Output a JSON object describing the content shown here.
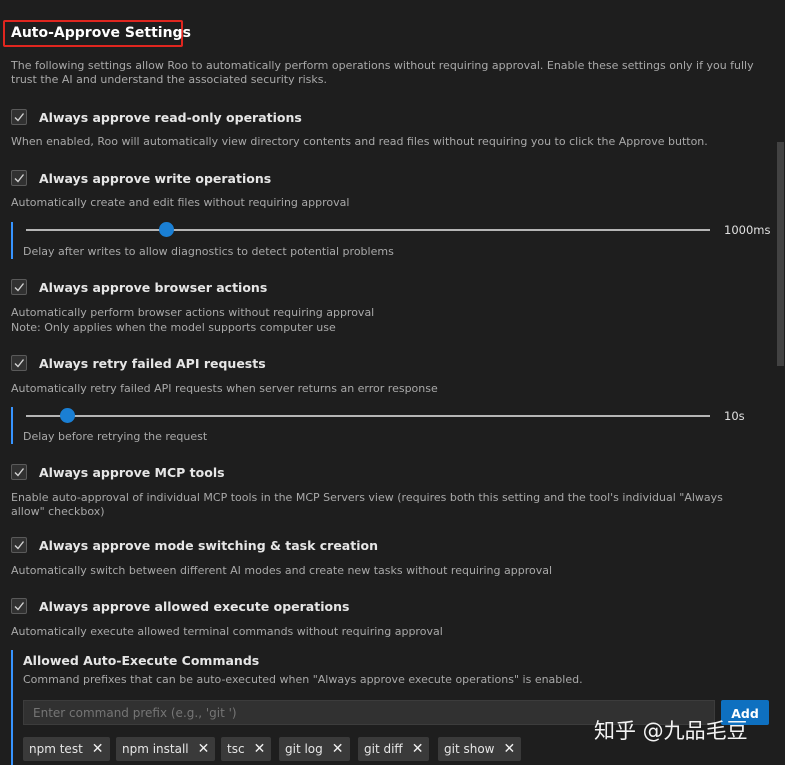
{
  "title": "Auto-Approve Settings",
  "intro": "The following settings allow Roo to automatically perform operations without requiring approval. Enable these settings only if you fully trust the AI and understand the associated security risks.",
  "settings": [
    {
      "label": "Always approve read-only operations",
      "checked": true,
      "desc": [
        "When enabled, Roo will automatically view directory contents and read files without requiring you to click the Approve button."
      ]
    },
    {
      "label": "Always approve write operations",
      "checked": true,
      "desc": [
        "Automatically create and edit files without requiring approval"
      ],
      "slider": {
        "value": "1000ms",
        "fraction": 0.2,
        "desc": "Delay after writes to allow diagnostics to detect potential problems"
      }
    },
    {
      "label": "Always approve browser actions",
      "checked": true,
      "desc": [
        "Automatically perform browser actions without requiring approval",
        "Note: Only applies when the model supports computer use"
      ]
    },
    {
      "label": "Always retry failed API requests",
      "checked": true,
      "desc": [
        "Automatically retry failed API requests when server returns an error response"
      ],
      "slider": {
        "value": "10s",
        "fraction": 0.06,
        "desc": "Delay before retrying the request"
      }
    },
    {
      "label": "Always approve MCP tools",
      "checked": true,
      "desc": [
        "Enable auto-approval of individual MCP tools in the MCP Servers view (requires both this setting and the tool's individual \"Always allow\" checkbox)"
      ]
    },
    {
      "label": "Always approve mode switching & task creation",
      "checked": true,
      "desc": [
        "Automatically switch between different AI modes and create new tasks without requiring approval"
      ]
    },
    {
      "label": "Always approve allowed execute operations",
      "checked": true,
      "desc": [
        "Automatically execute allowed terminal commands without requiring approval"
      ]
    }
  ],
  "allowed_commands": {
    "title": "Allowed Auto-Execute Commands",
    "desc": "Command prefixes that can be auto-executed when \"Always approve execute operations\" is enabled.",
    "placeholder": "Enter command prefix (e.g., 'git ')",
    "add_label": "Add",
    "tags": [
      "npm test",
      "npm install",
      "tsc",
      "git log",
      "git diff",
      "git show"
    ],
    "remove_glyph": "✕"
  },
  "watermark": "知乎 @九品毛豆",
  "colors": {
    "accent": "#3794ff",
    "button": "#0e70c0",
    "highlight_box": "#e0261f",
    "background": "#1e1e1e"
  }
}
